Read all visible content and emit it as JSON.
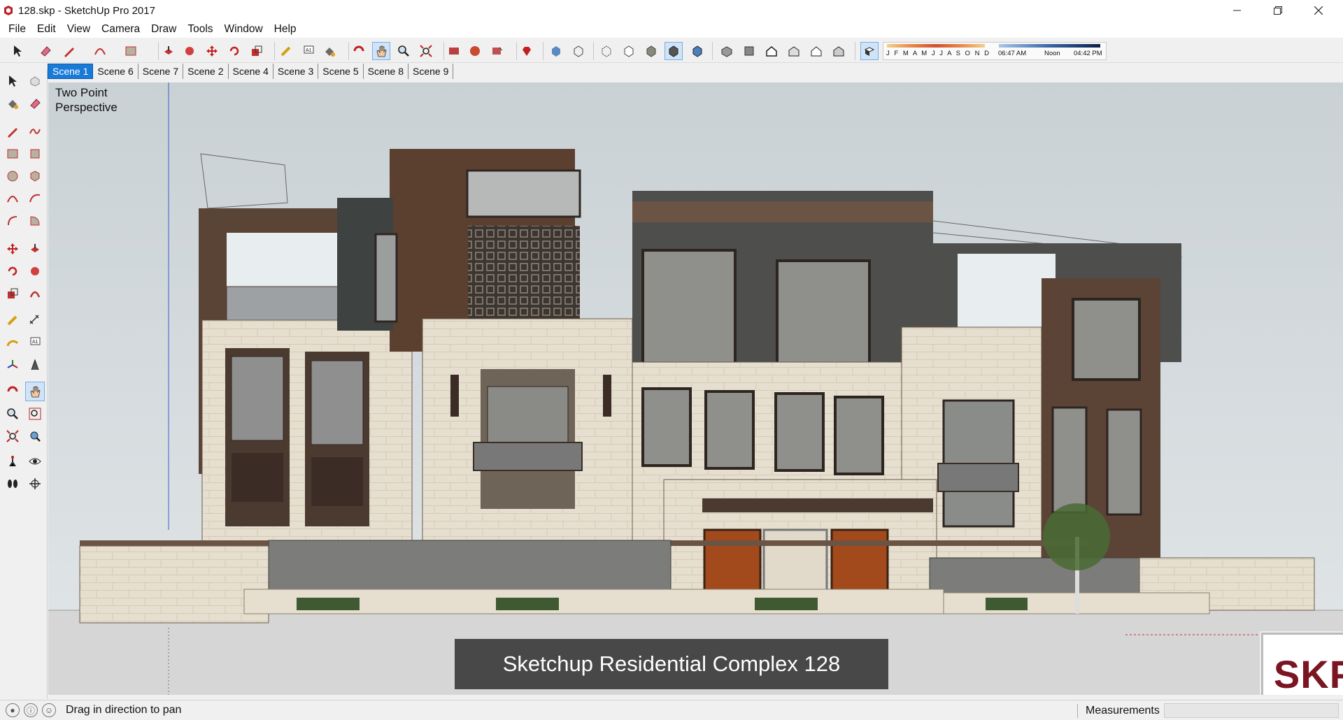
{
  "window": {
    "title": "128.skp - SketchUp Pro 2017",
    "controls": [
      "minimize",
      "maximize",
      "close"
    ]
  },
  "menu": [
    "File",
    "Edit",
    "View",
    "Camera",
    "Draw",
    "Tools",
    "Window",
    "Help"
  ],
  "toolbar": {
    "shadow_months": "J F M A M J J A S O N D",
    "time_start": "06:47 AM",
    "time_mid": "Noon",
    "time_end": "04:42 PM"
  },
  "scenes": [
    {
      "label": "Scene 1",
      "active": true
    },
    {
      "label": "Scene 6",
      "active": false
    },
    {
      "label": "Scene 7",
      "active": false
    },
    {
      "label": "Scene 2",
      "active": false
    },
    {
      "label": "Scene 4",
      "active": false
    },
    {
      "label": "Scene 3",
      "active": false
    },
    {
      "label": "Scene 5",
      "active": false
    },
    {
      "label": "Scene 8",
      "active": false
    },
    {
      "label": "Scene 9",
      "active": false
    }
  ],
  "viewport": {
    "perspective_label": "Two Point\nPerspective",
    "caption": "Sketchup Residential Complex 128",
    "logo": "SKP"
  },
  "status": {
    "hint": "Drag in direction to pan",
    "measurements_label": "Measurements",
    "measurements_value": ""
  },
  "colors": {
    "accent": "#1a7ad8",
    "sketchup_red": "#c0202a",
    "facade_stone": "#e4ddcc",
    "wood_brown": "#5b4030",
    "door_orange": "#b5521f"
  }
}
